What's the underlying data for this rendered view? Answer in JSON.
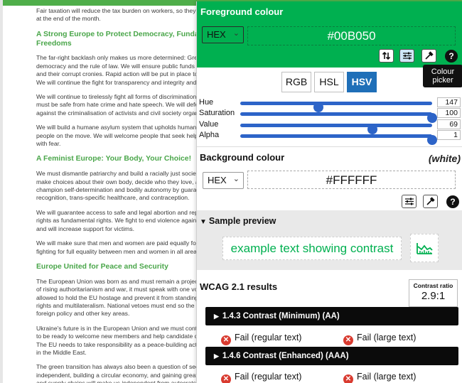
{
  "document": {
    "blocks": [
      {
        "type": "p",
        "text": "Fair taxation will reduce the tax burden on workers, so they h\nat the end of the month."
      },
      {
        "type": "h",
        "text": "A Strong Europe to Protect Democracy, Fundar\nFreedoms"
      },
      {
        "type": "p",
        "text": "The far-right backlash only makes us more determined: Gree\ndemocracy and the rule of law. We will ensure public funds b\nand their corrupt cronies. Rapid action will be put in place to\nWe will continue the fight for transparency and integrity and a"
      },
      {
        "type": "p",
        "text": "We will continue to tirelessly fight all forms of discrimination a\nmust be safe from hate crime and hate speech. We will defe\nagainst the criminalisation of activists and civil society organ"
      },
      {
        "type": "p",
        "text": "We will build a humane asylum system that upholds human r\npeople on the move. We will welcome people that seek help\nwith fear."
      },
      {
        "type": "h",
        "text": "A Feminist Europe: Your Body, Your Choice!"
      },
      {
        "type": "p",
        "text": "We must dismantle patriarchy and build a racially just society\nmake choices about their own body, decide who they love, a\nchampion self-determination and bodily autonomy by guaran\nrecognition, trans-specific healthcare, and contraception."
      },
      {
        "type": "p",
        "text": "We will guarantee access to safe and legal abortion and repr\nrights as fundamental rights. We fight to end violence agains\nand will increase support for victims."
      },
      {
        "type": "p",
        "text": "We will make sure that men and women are paid equally for\nfighting for full equality between men and women in all areas"
      },
      {
        "type": "h",
        "text": "Europe United for Peace and Security"
      },
      {
        "type": "p",
        "text": "The European Union was born as and must remain a project\nof rising authoritarianism and war, it must speak with one vo\nallowed to hold the EU hostage and prevent it from standing\nrights and multilateralism. National vetoes must end so the E\nforeign policy and other key areas."
      },
      {
        "type": "p",
        "text": "Ukraine's future is in the European Union and we must conti\nto be ready to welcome new members and help candidate co\nThe EU needs to take responsibility as a peace-building acto\nin the Middle East."
      },
      {
        "type": "p",
        "text": "The green transition has always also been a question of sec\nindependent, building a circular economy, and gaining great\nand supply chains will make us independent from autocrats a"
      }
    ]
  },
  "panel": {
    "foreground": {
      "title": "Foreground colour",
      "format": "HEX",
      "hex": "#00B050",
      "color": "#00b050",
      "tooltip_line1": "Colour",
      "tooltip_line2": "picker",
      "icons": [
        "swap-icon",
        "sliders-icon",
        "eyedropper-icon",
        "help-icon"
      ]
    },
    "modes": [
      "RGB",
      "HSL",
      "HSV"
    ],
    "active_mode": "HSV",
    "sliders": [
      {
        "label": "Hue",
        "value": "147",
        "fraction": 0.408
      },
      {
        "label": "Saturation",
        "value": "100",
        "fraction": 1.0
      },
      {
        "label": "Value",
        "value": "69",
        "fraction": 0.69
      },
      {
        "label": "Alpha",
        "value": "1",
        "fraction": 1.0
      }
    ],
    "background": {
      "title": "Background colour",
      "name": "(white)",
      "format": "HEX",
      "hex": "#FFFFFF"
    },
    "preview": {
      "title": "Sample preview",
      "sample_text": "example text showing contrast"
    },
    "wcag": {
      "title": "WCAG 2.1 results",
      "ratio_label": "Contrast ratio",
      "ratio_value": "2.9:1",
      "criteria": [
        {
          "label": "1.4.3 Contrast (Minimum) (AA)",
          "regular": "Fail (regular text)",
          "large": "Fail (large text)"
        },
        {
          "label": "1.4.6 Contrast (Enhanced) (AAA)",
          "regular": "Fail (regular text)",
          "large": "Fail (large text)"
        }
      ]
    },
    "colors": {
      "accent": "#1f6fb8",
      "slider": "#2d64c8",
      "fail": "#d93b30",
      "heading_green": "#4aa64a"
    }
  }
}
